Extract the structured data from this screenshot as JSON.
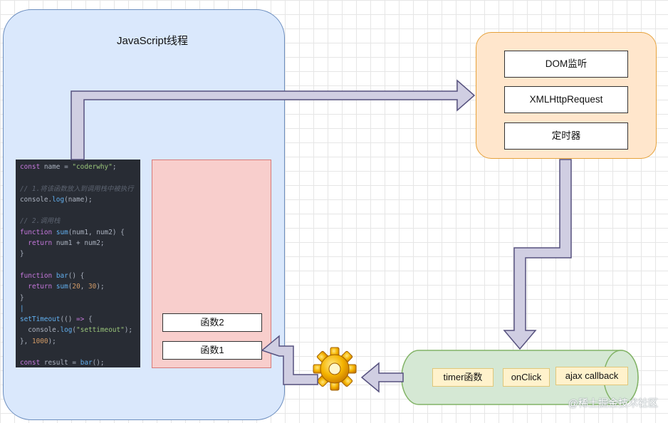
{
  "js_thread": {
    "title": "JavaScript线程"
  },
  "code_lines": [
    [
      {
        "t": "const",
        "c": "k"
      },
      {
        "t": " name = ",
        "c": ""
      },
      {
        "t": "\"coderwhy\"",
        "c": "s"
      },
      {
        "t": ";",
        "c": ""
      }
    ],
    [],
    [
      {
        "t": "// 1.将该函数放入到调用栈中被执行",
        "c": "c"
      }
    ],
    [
      {
        "t": "console.",
        "c": ""
      },
      {
        "t": "log",
        "c": "f"
      },
      {
        "t": "(name);",
        "c": ""
      }
    ],
    [],
    [
      {
        "t": "// 2.调用栈",
        "c": "c"
      }
    ],
    [
      {
        "t": "function",
        "c": "k"
      },
      {
        "t": " ",
        "c": ""
      },
      {
        "t": "sum",
        "c": "f"
      },
      {
        "t": "(num1, num2) {",
        "c": ""
      }
    ],
    [
      {
        "t": "  ",
        "c": ""
      },
      {
        "t": "return",
        "c": "k"
      },
      {
        "t": " num1 + num2;",
        "c": ""
      }
    ],
    [
      {
        "t": "}",
        "c": ""
      }
    ],
    [],
    [
      {
        "t": "function",
        "c": "k"
      },
      {
        "t": " ",
        "c": ""
      },
      {
        "t": "bar",
        "c": "f"
      },
      {
        "t": "() {",
        "c": ""
      }
    ],
    [
      {
        "t": "  ",
        "c": ""
      },
      {
        "t": "return",
        "c": "k"
      },
      {
        "t": " ",
        "c": ""
      },
      {
        "t": "sum",
        "c": "f"
      },
      {
        "t": "(",
        "c": ""
      },
      {
        "t": "20",
        "c": "n"
      },
      {
        "t": ", ",
        "c": ""
      },
      {
        "t": "30",
        "c": "n"
      },
      {
        "t": ");",
        "c": ""
      }
    ],
    [
      {
        "t": "}",
        "c": ""
      }
    ],
    [
      {
        "t": "|",
        "c": "f"
      }
    ],
    [
      {
        "t": "setTimeout",
        "c": "f"
      },
      {
        "t": "(() ",
        "c": ""
      },
      {
        "t": "=>",
        "c": "k"
      },
      {
        "t": " {",
        "c": ""
      }
    ],
    [
      {
        "t": "  console.",
        "c": ""
      },
      {
        "t": "log",
        "c": "f"
      },
      {
        "t": "(",
        "c": ""
      },
      {
        "t": "\"settimeout\"",
        "c": "s"
      },
      {
        "t": ");",
        "c": ""
      }
    ],
    [
      {
        "t": "}, ",
        "c": ""
      },
      {
        "t": "1000",
        "c": "n"
      },
      {
        "t": ");",
        "c": ""
      }
    ],
    [],
    [
      {
        "t": "const",
        "c": "k"
      },
      {
        "t": " result = ",
        "c": ""
      },
      {
        "t": "bar",
        "c": "f"
      },
      {
        "t": "();",
        "c": ""
      }
    ]
  ],
  "call_stack": {
    "items": [
      "函数2",
      "函数1"
    ]
  },
  "web_apis": {
    "items": [
      "DOM监听",
      "XMLHttpRequest",
      "定时器"
    ]
  },
  "event_queue": {
    "items": [
      "timer函数",
      "onClick",
      "ajax callback"
    ]
  },
  "watermark": "@稀土掘金技术社区",
  "colors": {
    "thread_fill": "#dae8fc",
    "stack_fill": "#f8cecc",
    "api_fill": "#ffe6cc",
    "queue_fill": "#d5e8d4",
    "arrow_fill": "#d0cee2",
    "arrow_stroke": "#56517e"
  },
  "icons": {
    "event_loop": "gear-icon"
  }
}
